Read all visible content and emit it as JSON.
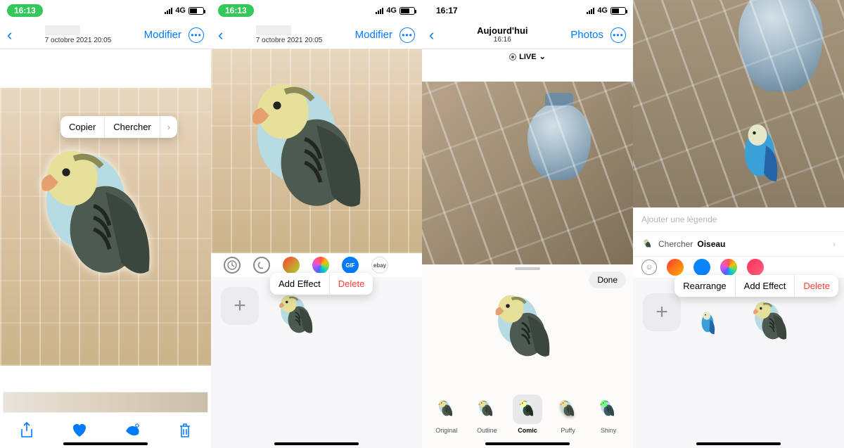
{
  "screen1": {
    "status_time": "16:13",
    "network": "4G",
    "battery_pct": 55,
    "nav_date": "7 octobre 2021  20:05",
    "nav_edit": "Modifier",
    "callout": {
      "copy": "Copier",
      "search": "Chercher"
    },
    "bottombar": {
      "share": "share",
      "favorite": "favorite",
      "lookup": "bird-lookup",
      "trash": "trash"
    }
  },
  "screen2": {
    "status_time": "16:13",
    "network": "4G",
    "battery_pct": 64,
    "nav_date": "7 octobre 2021  20:05",
    "nav_edit": "Modifier",
    "app_strip": [
      "clock",
      "moon",
      "flame",
      "photo",
      "gif",
      "ebay"
    ],
    "callout": {
      "add_effect": "Add Effect",
      "delete": "Delete"
    }
  },
  "screen3": {
    "status_time": "16:17",
    "network": "4G",
    "battery_pct": 58,
    "nav_title": "Aujourd'hui",
    "nav_subtitle": "16:16",
    "nav_right": "Photos",
    "live_label": "LIVE",
    "done": "Done",
    "effects": [
      "Original",
      "Outline",
      "Comic",
      "Puffy",
      "Shiny"
    ],
    "selected_effect": 2
  },
  "screen4": {
    "caption_placeholder": "Ajouter une légende",
    "lookup_prefix": "Chercher",
    "lookup_term": "Oiseau",
    "callout": {
      "rearrange": "Rearrange",
      "add_effect": "Add Effect",
      "delete": "Delete"
    }
  }
}
